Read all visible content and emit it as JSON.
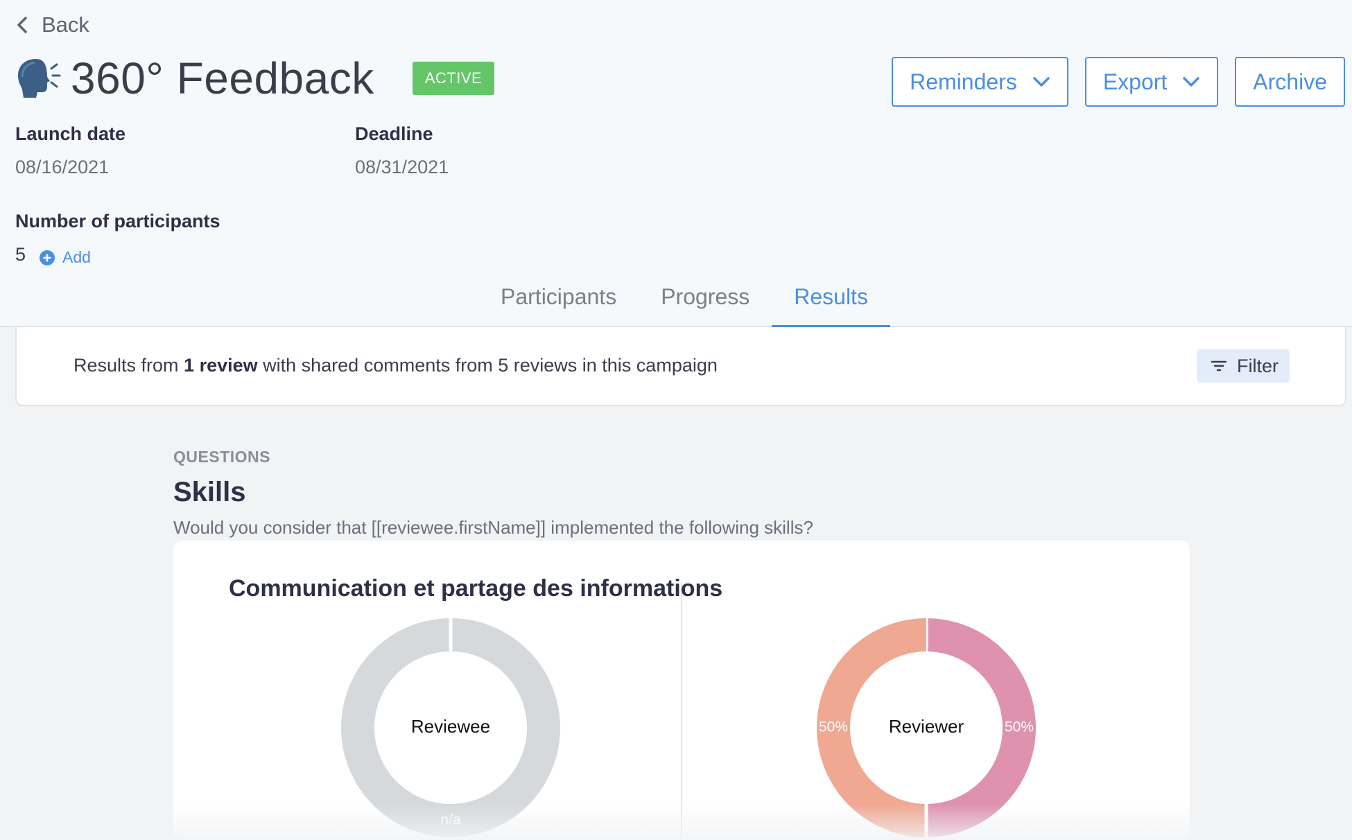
{
  "nav": {
    "back_label": "Back"
  },
  "campaign": {
    "title": "360° Feedback",
    "status": "ACTIVE",
    "status_color": "#63c667",
    "icon": "speaking-head-icon"
  },
  "actions": {
    "reminders_label": "Reminders",
    "export_label": "Export",
    "archive_label": "Archive"
  },
  "meta": {
    "launch_label": "Launch date",
    "launch_value": "08/16/2021",
    "deadline_label": "Deadline",
    "deadline_value": "08/31/2021",
    "participants_label": "Number of participants",
    "participants_value": "5",
    "add_label": "Add"
  },
  "tabs": [
    {
      "label": "Participants",
      "active": false
    },
    {
      "label": "Progress",
      "active": false
    },
    {
      "label": "Results",
      "active": true
    }
  ],
  "results_bar": {
    "prefix": "Results from ",
    "review_count": "1 review",
    "suffix": " with shared comments from 5 reviews in this campaign",
    "filter_label": "Filter"
  },
  "question": {
    "section_label": "QUESTIONS",
    "title": "Skills",
    "description": "Would you consider that [[reviewee.firstName]] implemented the following skills?"
  },
  "skill_card": {
    "title": "Communication et partage des informations",
    "charts": [
      {
        "center_label": "Reviewee",
        "slices": [
          {
            "label": "n/a",
            "value": 100,
            "color": "#d5d9dc"
          }
        ]
      },
      {
        "center_label": "Reviewer",
        "slices": [
          {
            "label": "50%",
            "value": 50,
            "color": "#de92ae"
          },
          {
            "label": "50%",
            "value": 50,
            "color": "#f0a893"
          }
        ]
      }
    ]
  },
  "colors": {
    "accent": "#4a8fe0",
    "header_bg": "#f6f9fc",
    "page_bg": "#f1f3f5"
  }
}
